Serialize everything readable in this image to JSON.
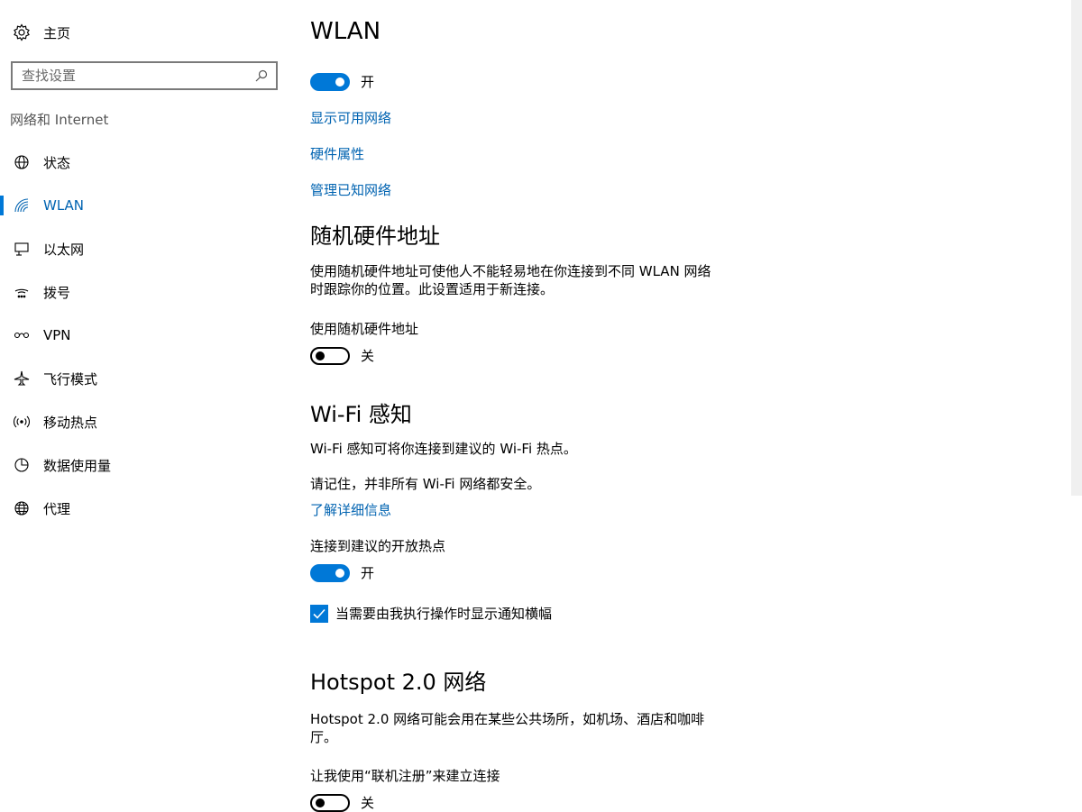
{
  "sidebar": {
    "home_label": "主页",
    "search_placeholder": "查找设置",
    "section_label": "网络和 Internet",
    "items": [
      {
        "label": "状态",
        "icon": "globe-status-icon"
      },
      {
        "label": "WLAN",
        "icon": "wifi-icon"
      },
      {
        "label": "以太网",
        "icon": "ethernet-icon"
      },
      {
        "label": "拨号",
        "icon": "dialup-icon"
      },
      {
        "label": "VPN",
        "icon": "vpn-icon"
      },
      {
        "label": "飞行模式",
        "icon": "airplane-icon"
      },
      {
        "label": "移动热点",
        "icon": "hotspot-icon"
      },
      {
        "label": "数据使用量",
        "icon": "pie-chart-icon"
      },
      {
        "label": "代理",
        "icon": "globe-icon"
      }
    ],
    "active_item": "WLAN"
  },
  "main": {
    "title": "WLAN",
    "wlan_toggle": {
      "state": "on",
      "label": "开"
    },
    "links": {
      "show_networks": "显示可用网络",
      "hardware_properties": "硬件属性",
      "manage_known": "管理已知网络"
    },
    "random_hw": {
      "heading": "随机硬件地址",
      "description_line1": "使用随机硬件地址可使他人不能轻易地在你连接到不同 WLAN 网络",
      "description_line2": "时跟踪你的位置。此设置适用于新连接。",
      "toggle_label": "使用随机硬件地址",
      "toggle_state": "off",
      "toggle_text": "关"
    },
    "wifi_sense": {
      "heading": "Wi-Fi 感知",
      "description": "Wi-Fi 感知可将你连接到建议的 Wi-Fi 热点。",
      "reminder": "请记住，并非所有 Wi-Fi 网络都安全。",
      "learn_more": "了解详细信息",
      "toggle_label": "连接到建议的开放热点",
      "toggle_state": "on",
      "toggle_text": "开",
      "checkbox_label": "当需要由我执行操作时显示通知横幅",
      "checkbox_checked": true
    },
    "hotspot2": {
      "heading": "Hotspot 2.0 网络",
      "description_line1": "Hotspot 2.0 网络可能会用在某些公共场所，如机场、酒店和咖啡",
      "description_line2": "厅。",
      "toggle_label": "让我使用“联机注册”来建立连接",
      "toggle_state": "off",
      "toggle_text": "关"
    }
  },
  "colors": {
    "accent": "#0078d7",
    "link": "#0063b1"
  }
}
